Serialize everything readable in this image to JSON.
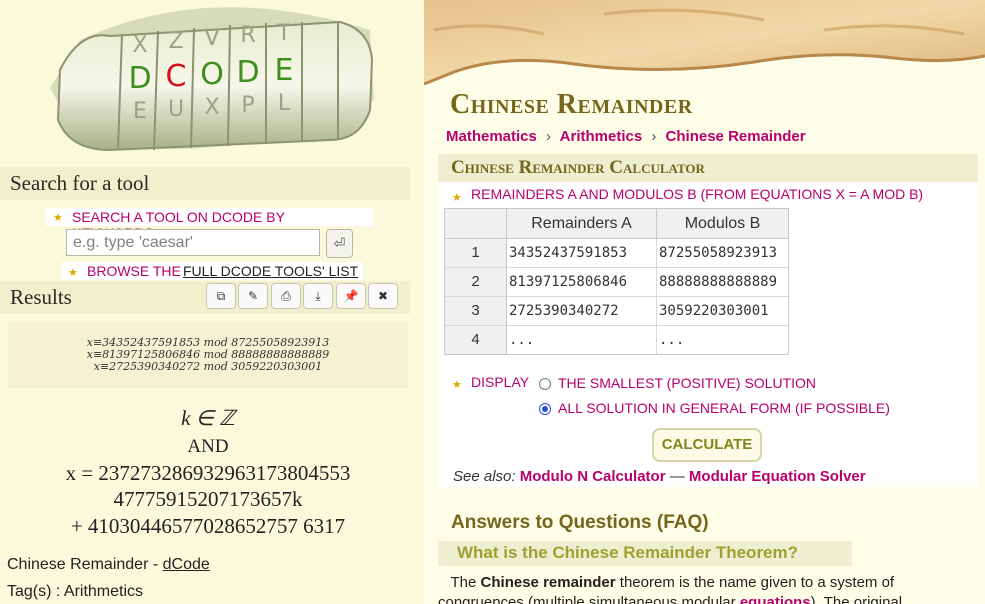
{
  "logo": {
    "letters": [
      "D",
      "C",
      "O",
      "D",
      "E"
    ]
  },
  "search": {
    "heading": "Search for a tool",
    "keyword_label": "SEARCH A TOOL ON DCODE BY KEYWORDS:",
    "placeholder": "e.g. type 'caesar'",
    "go_glyph": "⏎",
    "browse_prefix": "BROWSE THE",
    "browse_link": "FULL DCODE TOOLS' LIST"
  },
  "results": {
    "heading": "Results",
    "toolbar": [
      {
        "name": "copy-icon",
        "glyph": "⧉"
      },
      {
        "name": "edit-icon",
        "glyph": "✎"
      },
      {
        "name": "print-icon",
        "glyph": "⎙"
      },
      {
        "name": "download-icon",
        "glyph": "⤓"
      },
      {
        "name": "pin-icon",
        "glyph": "📌"
      },
      {
        "name": "close-icon",
        "glyph": "✖"
      }
    ],
    "equations": [
      "x≡34352437591853 mod 87255058923913",
      "x≡81397125806846 mod 88888888888889",
      "x≡2725390340272 mod 3059220303001"
    ],
    "k_line": "k ∈ ℤ",
    "and_label": "AND",
    "x_line1": "x = 237273286932963173804553",
    "x_line2": "47775915207173657k",
    "x_line3": "+ 41030446577028652757 6317",
    "source_prefix": "Chinese Remainder -",
    "source_link": "dCode",
    "tags": "Tag(s) : Arithmetics"
  },
  "page": {
    "title": "Chinese Remainder",
    "breadcrumb": [
      "Mathematics",
      "Arithmetics",
      "Chinese Remainder"
    ],
    "breadcrumb_sep": "›"
  },
  "calculator": {
    "heading": "Chinese Remainder Calculator",
    "inputs_label": "REMAINDERS A AND MODULOS B (FROM EQUATIONS X = A MOD B)",
    "columns": [
      "Remainders A",
      "Modulos B"
    ],
    "rows": [
      {
        "n": "1",
        "a": "34352437591853",
        "b": "87255058923913"
      },
      {
        "n": "2",
        "a": "81397125806846",
        "b": "88888888888889"
      },
      {
        "n": "3",
        "a": "2725390340272",
        "b": "3059220303001"
      },
      {
        "n": "4",
        "a": "...",
        "b": "..."
      }
    ],
    "display_label": "DISPLAY",
    "options": [
      {
        "label": "THE SMALLEST (POSITIVE) SOLUTION",
        "selected": false
      },
      {
        "label": "ALL SOLUTION IN GENERAL FORM (IF POSSIBLE)",
        "selected": true
      }
    ],
    "button": "CALCULATE",
    "see_also_label": "See also:",
    "see_also": [
      "Modulo N Calculator",
      "Modular Equation Solver"
    ],
    "see_also_sep": "—"
  },
  "faq": {
    "title": "Answers to Questions (FAQ)",
    "question": "What is the Chinese Remainder Theorem?",
    "answer_pre": "The",
    "answer_bold": "Chinese remainder",
    "answer_mid": "theorem is the name given to a system of congruences (multiple simultaneous modular",
    "answer_link": "equations",
    "answer_post": "). The original"
  }
}
